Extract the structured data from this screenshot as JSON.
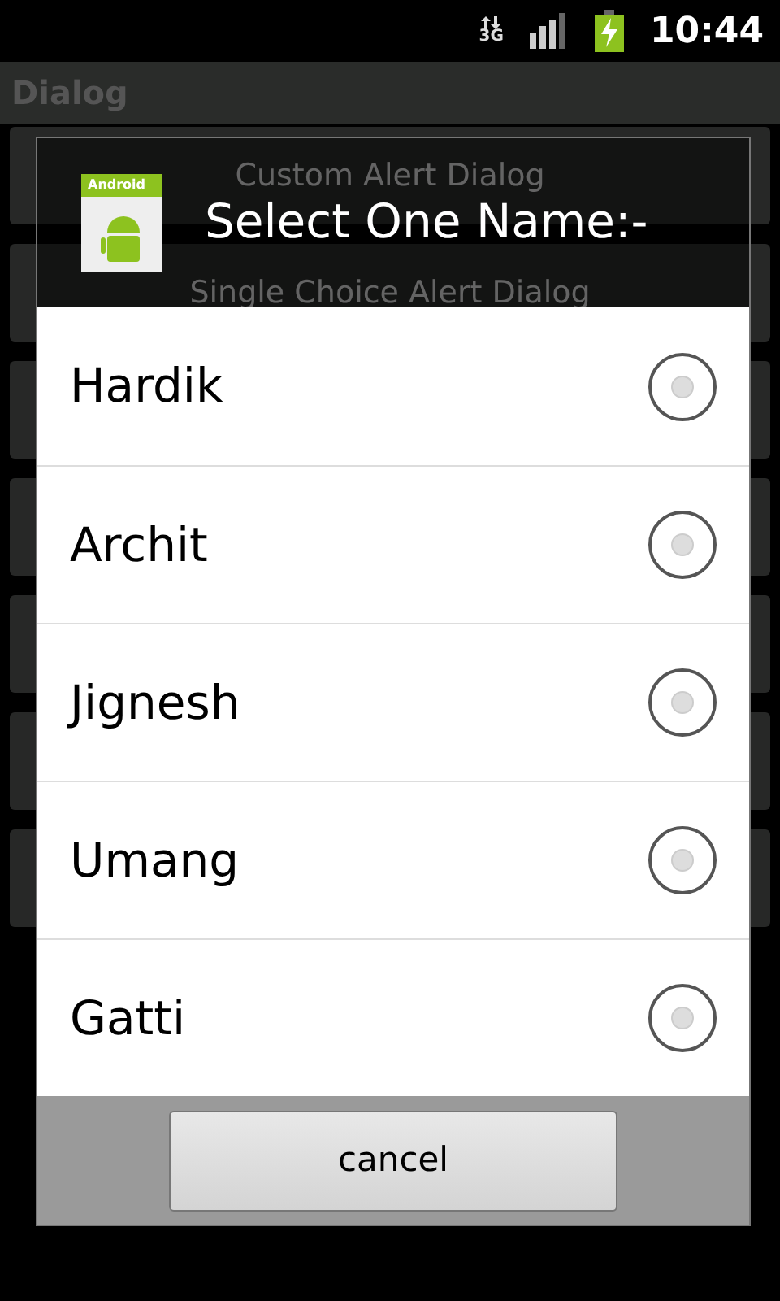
{
  "status_bar": {
    "network": "3G",
    "time": "10:44"
  },
  "app_bar": {
    "title": "Dialog"
  },
  "background_buttons": [
    {
      "label": "Custom Alert Dialog"
    },
    {
      "label": "Single Choice Alert Dialog"
    }
  ],
  "dialog": {
    "icon_label": "Android",
    "title": "Select One Name:-",
    "options": [
      {
        "label": "Hardik",
        "selected": false
      },
      {
        "label": "Archit",
        "selected": false
      },
      {
        "label": "Jignesh",
        "selected": false
      },
      {
        "label": "Umang",
        "selected": false
      },
      {
        "label": "Gatti",
        "selected": false
      }
    ],
    "buttons": [
      "cancel"
    ]
  }
}
